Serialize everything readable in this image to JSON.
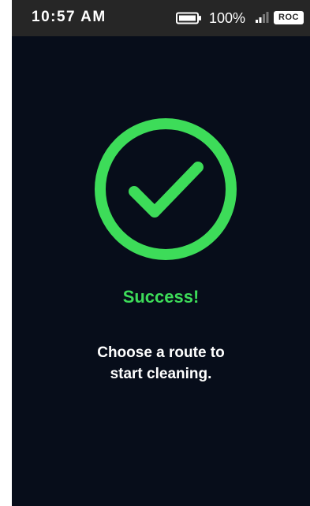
{
  "status_bar": {
    "time": "10:57 AM",
    "battery_percent": "100%",
    "battery_icon": "battery-full-icon",
    "signal_icon": "signal-bars-icon",
    "carrier_badge": "ROC"
  },
  "success_screen": {
    "icon": "check-circle-icon",
    "title": "Success!",
    "message_line1": "Choose a route to",
    "message_line2": "start cleaning."
  },
  "colors": {
    "background": "#070d1a",
    "status_bar": "#262626",
    "accent_green": "#3ddc59",
    "text": "#ffffff"
  }
}
